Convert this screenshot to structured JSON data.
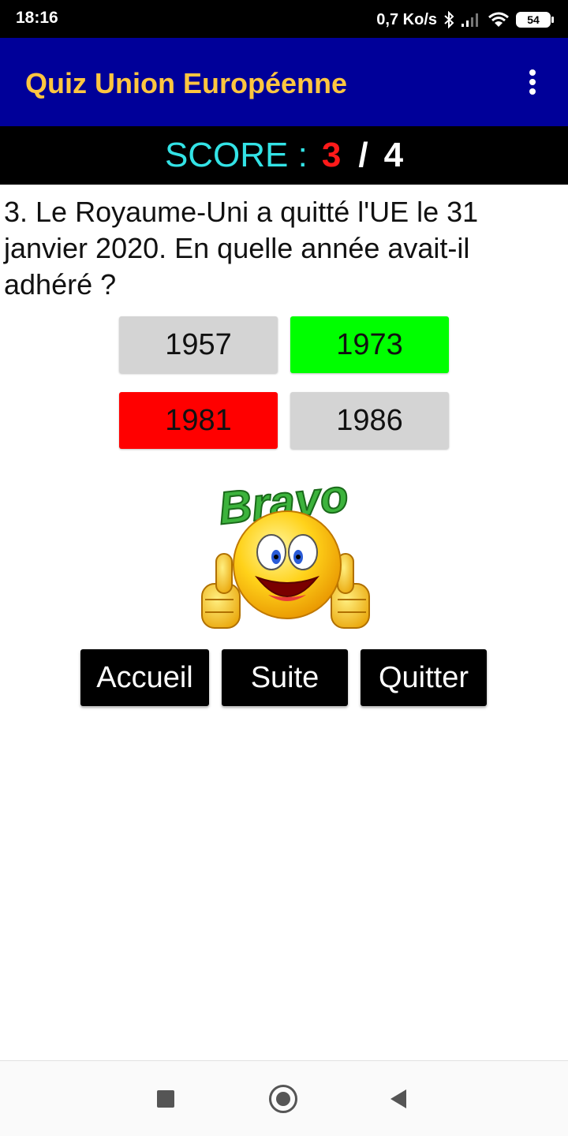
{
  "status_bar": {
    "time": "18:16",
    "network_speed": "0,7 Ko/s",
    "battery": "54",
    "icons": [
      "bluetooth-icon",
      "signal-icon",
      "wifi-icon",
      "battery-icon"
    ]
  },
  "app_bar": {
    "title": "Quiz Union Européenne",
    "menu_icon": "more-vert-icon"
  },
  "score": {
    "label": "SCORE :",
    "value": "3",
    "separator": "/",
    "total": "4"
  },
  "question": {
    "text": "3. Le Royaume-Uni a quitté l'UE le 31 janvier 2020. En quelle année avait-il adhéré ?"
  },
  "answers": [
    {
      "label": "1957",
      "state": "neutral",
      "color": "#d4d4d4"
    },
    {
      "label": "1973",
      "state": "correct",
      "color": "#00ff00"
    },
    {
      "label": "1981",
      "state": "wrong",
      "color": "#ff0000"
    },
    {
      "label": "1986",
      "state": "neutral",
      "color": "#d4d4d4"
    }
  ],
  "feedback_image": {
    "text": "Bravo",
    "icon": "smiley-thumbs-up-icon"
  },
  "buttons": {
    "home": "Accueil",
    "next": "Suite",
    "quit": "Quitter"
  },
  "colors": {
    "app_bar": "#000099",
    "title": "#ffc640",
    "score_label": "#33e3e6",
    "score_value": "#ff1a1a"
  },
  "system_nav": {
    "icons": [
      "recent-apps-icon",
      "home-icon",
      "back-icon"
    ]
  }
}
